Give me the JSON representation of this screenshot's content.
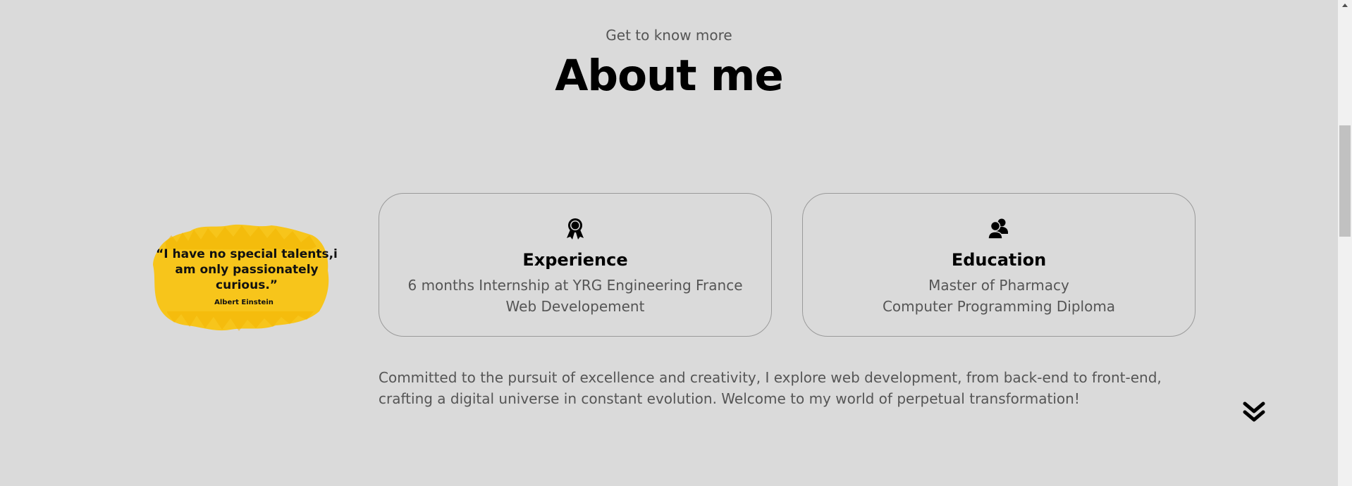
{
  "header": {
    "subtitle": "Get to know more",
    "title": "About me"
  },
  "quote": {
    "text": "“I have no special talents,i am only passionately curious.”",
    "author": "Albert Einstein",
    "highlight_color": "#f7c51b"
  },
  "cards": [
    {
      "icon": "award-ribbon-icon",
      "title": "Experience",
      "lines": [
        "6 months Internship at YRG Engineering France",
        "Web Developement"
      ]
    },
    {
      "icon": "users-icon",
      "title": "Education",
      "lines": [
        "Master of Pharmacy",
        "Computer Programming Diploma"
      ]
    }
  ],
  "description": "Committed to the pursuit of excellence and creativity, I explore web development, from back-end to front-end, crafting a digital universe in constant evolution. Welcome to my world of perpetual transformation!",
  "scroll_down": {
    "icon": "double-chevron-down-icon"
  },
  "colors": {
    "background": "#dadada",
    "text_primary": "#000000",
    "text_secondary": "#555555",
    "card_border": "#9a9a9a"
  }
}
